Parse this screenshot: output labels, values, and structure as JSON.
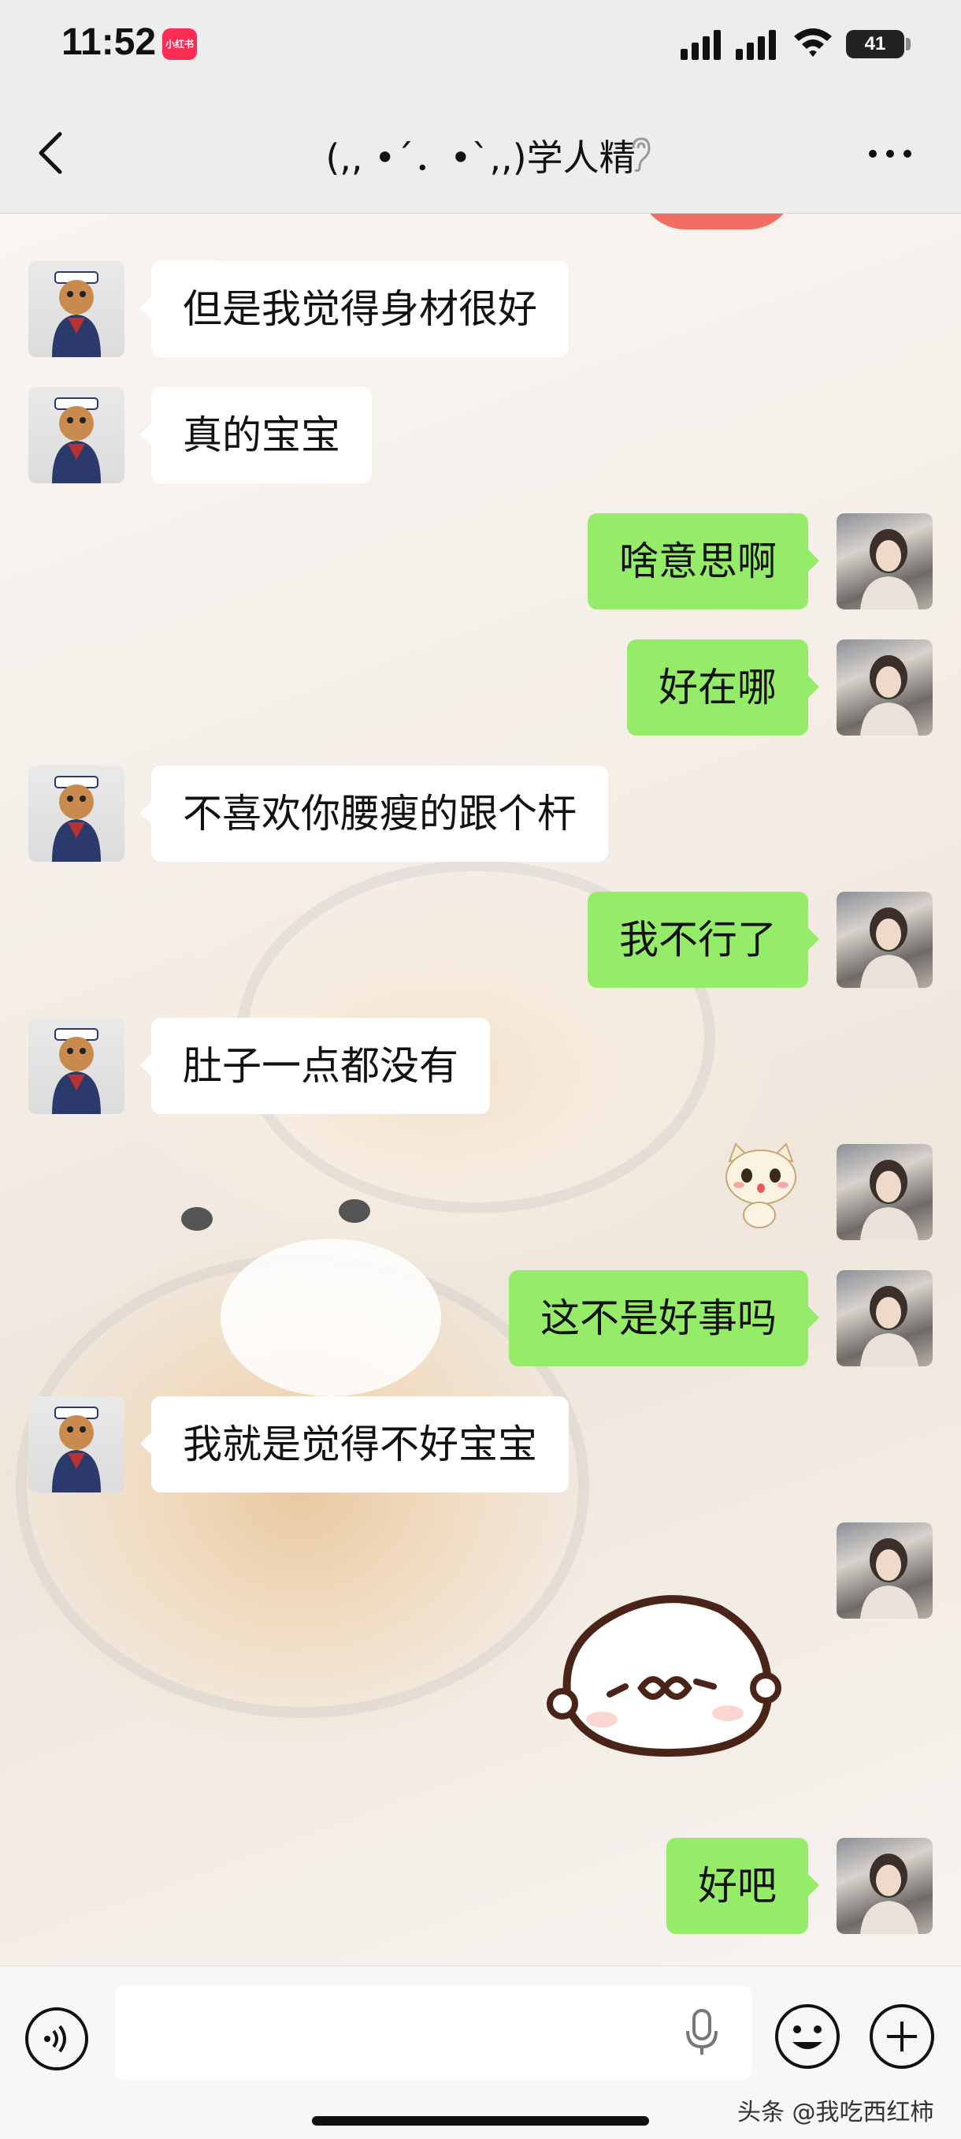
{
  "status_bar": {
    "time": "11:52",
    "app_badge": "小红书",
    "battery": "41"
  },
  "nav": {
    "title": "(,, •´．•`,,)学人精"
  },
  "messages": [
    {
      "side": "in",
      "text": "但是我觉得身材很好"
    },
    {
      "side": "in",
      "text": "真的宝宝"
    },
    {
      "side": "out",
      "text": "啥意思啊"
    },
    {
      "side": "out",
      "text": "好在哪"
    },
    {
      "side": "in",
      "text": "不喜欢你腰瘦的跟个杆"
    },
    {
      "side": "out",
      "text": "我不行了"
    },
    {
      "side": "in",
      "text": "肚子一点都没有"
    },
    {
      "side": "out",
      "text": "[sticker-cat]"
    },
    {
      "side": "out",
      "text": "这不是好事吗"
    },
    {
      "side": "in",
      "text": "我就是觉得不好宝宝"
    },
    {
      "side": "out",
      "text": "[sticker-blob]"
    },
    {
      "side": "out",
      "text": "好吧"
    }
  ],
  "watermark": "头条 @我吃西红柿",
  "colors": {
    "outgoing_bubble": "#95ec69",
    "incoming_bubble": "#ffffff"
  }
}
